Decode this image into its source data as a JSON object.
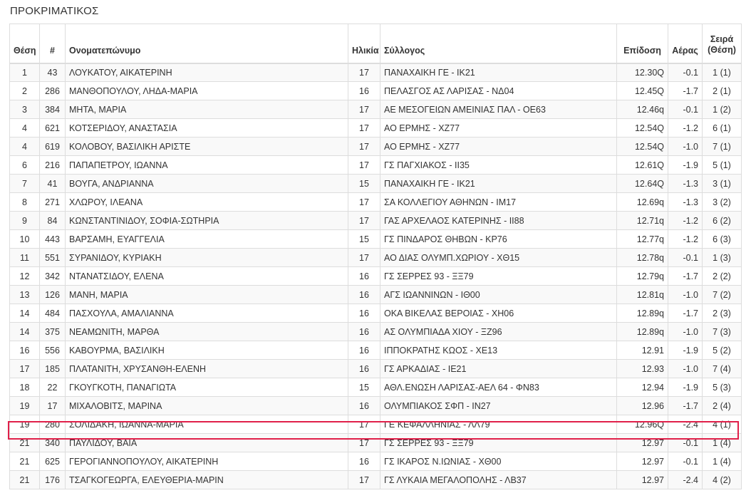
{
  "page": {
    "title": "ΠΡΟΚΡΙΜΑΤΙΚΟΣ"
  },
  "table": {
    "headers": {
      "position": "Θέση",
      "bib": "#",
      "name": "Ονοματεπώνυμο",
      "age": "Ηλικία",
      "club": "Σύλλογος",
      "mark": "Επίδοση",
      "wind": "Αέρας",
      "heat_line1": "Σειρά",
      "heat_line2": "(Θέση)"
    },
    "rows": [
      {
        "position": "1",
        "bib": "43",
        "name": "ΛΟΥΚΑΤΟΥ, ΑΙΚΑΤΕΡΙΝΗ",
        "age": "17",
        "club": "ΠΑΝΑΧΑΙΚΗ ΓΕ - ΙΚ21",
        "mark": "12.30Q",
        "wind": "-0.1",
        "heat": "1 (1)"
      },
      {
        "position": "2",
        "bib": "286",
        "name": "ΜΑΝΘΟΠΟΥΛΟΥ, ΛΗΔΑ-ΜΑΡΙΑ",
        "age": "16",
        "club": "ΠΕΛΑΣΓΟΣ ΑΣ ΛΑΡΙΣΑΣ - ΝΔ04",
        "mark": "12.45Q",
        "wind": "-1.7",
        "heat": "2 (1)"
      },
      {
        "position": "3",
        "bib": "384",
        "name": "ΜΗΤΑ, ΜΑΡΙΑ",
        "age": "17",
        "club": "ΑΕ ΜΕΣΟΓΕΙΩΝ ΑΜΕΙΝΙΑΣ ΠΑΛ - ΟΕ63",
        "mark": "12.46q",
        "wind": "-0.1",
        "heat": "1 (2)"
      },
      {
        "position": "4",
        "bib": "621",
        "name": "ΚΟΤΣΕΡΙΔΟΥ, ΑΝΑΣΤΑΣΙΑ",
        "age": "17",
        "club": "ΑΟ ΕΡΜΗΣ - ΧΖ77",
        "mark": "12.54Q",
        "wind": "-1.2",
        "heat": "6 (1)"
      },
      {
        "position": "4",
        "bib": "619",
        "name": "ΚΟΛΟΒΟΥ, ΒΑΣΙΛΙΚΗ ΑΡΙΣΤΕ",
        "age": "17",
        "club": "ΑΟ ΕΡΜΗΣ - ΧΖ77",
        "mark": "12.54Q",
        "wind": "-1.0",
        "heat": "7 (1)"
      },
      {
        "position": "6",
        "bib": "216",
        "name": "ΠΑΠΑΠΕΤΡΟΥ, ΙΩΑΝΝΑ",
        "age": "17",
        "club": "ΓΣ ΠΑΓΧΙΑΚΟΣ - ΙΙ35",
        "mark": "12.61Q",
        "wind": "-1.9",
        "heat": "5 (1)"
      },
      {
        "position": "7",
        "bib": "41",
        "name": "ΒΟΥΓΑ, ΑΝΔΡΙΑΝΝΑ",
        "age": "15",
        "club": "ΠΑΝΑΧΑΙΚΗ ΓΕ - ΙΚ21",
        "mark": "12.64Q",
        "wind": "-1.3",
        "heat": "3 (1)"
      },
      {
        "position": "8",
        "bib": "271",
        "name": "ΧΛΩΡΟΥ, ΙΛΕΑΝΑ",
        "age": "17",
        "club": "ΣΑ ΚΟΛΛΕΓΙΟΥ ΑΘΗΝΩΝ - ΙΜ17",
        "mark": "12.69q",
        "wind": "-1.3",
        "heat": "3 (2)"
      },
      {
        "position": "9",
        "bib": "84",
        "name": "ΚΩΝΣΤΑΝΤΙΝΙΔΟΥ, ΣΟΦΙΑ-ΣΩΤΗΡΙΑ",
        "age": "17",
        "club": "ΓΑΣ ΑΡΧΕΛΑΟΣ ΚΑΤΕΡΙΝΗΣ - ΙΙ88",
        "mark": "12.71q",
        "wind": "-1.2",
        "heat": "6 (2)"
      },
      {
        "position": "10",
        "bib": "443",
        "name": "ΒΑΡΣΑΜΗ, ΕΥΑΓΓΕΛΙΑ",
        "age": "15",
        "club": "ΓΣ ΠΙΝΔΑΡΟΣ ΘΗΒΩΝ - ΚΡ76",
        "mark": "12.77q",
        "wind": "-1.2",
        "heat": "6 (3)"
      },
      {
        "position": "11",
        "bib": "551",
        "name": "ΣΥΡΑΝΙΔΟΥ, ΚΥΡΙΑΚΗ",
        "age": "17",
        "club": "ΑΟ ΔΙΑΣ ΟΛΥΜΠ.ΧΩΡΙΟΥ - ΧΘ15",
        "mark": "12.78q",
        "wind": "-0.1",
        "heat": "1 (3)"
      },
      {
        "position": "12",
        "bib": "342",
        "name": "ΝΤΑΝΑΤΣΙΔΟΥ, ΕΛΕΝΑ",
        "age": "16",
        "club": "ΓΣ ΣΕΡΡΕΣ 93 - ΞΞ79",
        "mark": "12.79q",
        "wind": "-1.7",
        "heat": "2 (2)"
      },
      {
        "position": "13",
        "bib": "126",
        "name": "ΜΑΝΗ, ΜΑΡΙΑ",
        "age": "16",
        "club": "ΑΓΣ ΙΩΑΝΝΙΝΩΝ - ΙΘ00",
        "mark": "12.81q",
        "wind": "-1.0",
        "heat": "7 (2)"
      },
      {
        "position": "14",
        "bib": "484",
        "name": "ΠΑΣΧΟΥΛΑ, ΑΜΑΛΙΑΝΝΑ",
        "age": "16",
        "club": "ΟΚΑ ΒΙΚΕΛΑΣ ΒΕΡΟΙΑΣ - ΧΗ06",
        "mark": "12.89q",
        "wind": "-1.7",
        "heat": "2 (3)"
      },
      {
        "position": "14",
        "bib": "375",
        "name": "ΝΕΑΜΩΝΙΤΗ, ΜΑΡΘΑ",
        "age": "16",
        "club": "ΑΣ ΟΛΥΜΠΙΑΔΑ ΧΙΟΥ - ΞΖ96",
        "mark": "12.89q",
        "wind": "-1.0",
        "heat": "7 (3)"
      },
      {
        "position": "16",
        "bib": "556",
        "name": "ΚΑΒΟΥΡΜΑ, ΒΑΣΙΛΙΚΗ",
        "age": "16",
        "club": "ΙΠΠΟΚΡΑΤΗΣ ΚΩΟΣ - ΧΕ13",
        "mark": "12.91",
        "wind": "-1.9",
        "heat": "5 (2)"
      },
      {
        "position": "17",
        "bib": "185",
        "name": "ΠΛΑΤΑΝΙΤΗ, ΧΡΥΣΑΝΘΗ-ΕΛΕΝΗ",
        "age": "16",
        "club": "ΓΣ ΑΡΚΑΔΙΑΣ - ΙΕ21",
        "mark": "12.93",
        "wind": "-1.0",
        "heat": "7 (4)"
      },
      {
        "position": "18",
        "bib": "22",
        "name": "ΓΚΟΥΓΚΟΤΗ, ΠΑΝΑΓΙΩΤΑ",
        "age": "15",
        "club": "ΑΘΛ.ΕΝΩΣΗ ΛΑΡΙΣΑΣ-ΑΕΛ 64 - ΦΝ83",
        "mark": "12.94",
        "wind": "-1.9",
        "heat": "5 (3)"
      },
      {
        "position": "19",
        "bib": "17",
        "name": "ΜΙΧΑΛΟΒΙΤΣ, ΜΑΡΙΝΑ",
        "age": "16",
        "club": "ΟΛΥΜΠΙΑΚΟΣ ΣΦΠ - ΙΝ27",
        "mark": "12.96",
        "wind": "-1.7",
        "heat": "2 (4)"
      },
      {
        "position": "19",
        "bib": "280",
        "name": "ΣΟΛΙΔΑΚΗ, ΙΩΑΝΝΑ-ΜΑΡΙΑ",
        "age": "17",
        "club": "ΓΕ ΚΕΦΑΛΛΗΝΙΑΣ - ΛΛ79",
        "mark": "12.96Q",
        "wind": "-2.4",
        "heat": "4 (1)"
      },
      {
        "position": "21",
        "bib": "340",
        "name": "ΠΑΥΛΙΔΟΥ, ΒΑΙΑ",
        "age": "17",
        "club": "ΓΣ ΣΕΡΡΕΣ 93 - ΞΞ79",
        "mark": "12.97",
        "wind": "-0.1",
        "heat": "1 (4)"
      },
      {
        "position": "21",
        "bib": "625",
        "name": "ΓΕΡΟΓΙΑΝΝΟΠΟΥΛΟΥ, ΑΙΚΑΤΕΡΙΝΗ",
        "age": "16",
        "club": "ΓΣ ΙΚΑΡΟΣ Ν.ΙΩΝΙΑΣ - ΧΘ00",
        "mark": "12.97",
        "wind": "-0.1",
        "heat": "1 (4)"
      },
      {
        "position": "21",
        "bib": "176",
        "name": "ΤΣΑΓΚΟΓΕΩΡΓΑ, ΕΛΕΥΘΕΡΙΑ-ΜΑΡΙΝ",
        "age": "17",
        "club": "ΓΣ ΛΥΚΑΙΑ ΜΕΓΑΛΟΠΟΛΗΣ - ΛΒ37",
        "mark": "12.97",
        "wind": "-2.4",
        "heat": "4 (2)"
      }
    ]
  },
  "highlight": {
    "color": "#e0204a"
  }
}
